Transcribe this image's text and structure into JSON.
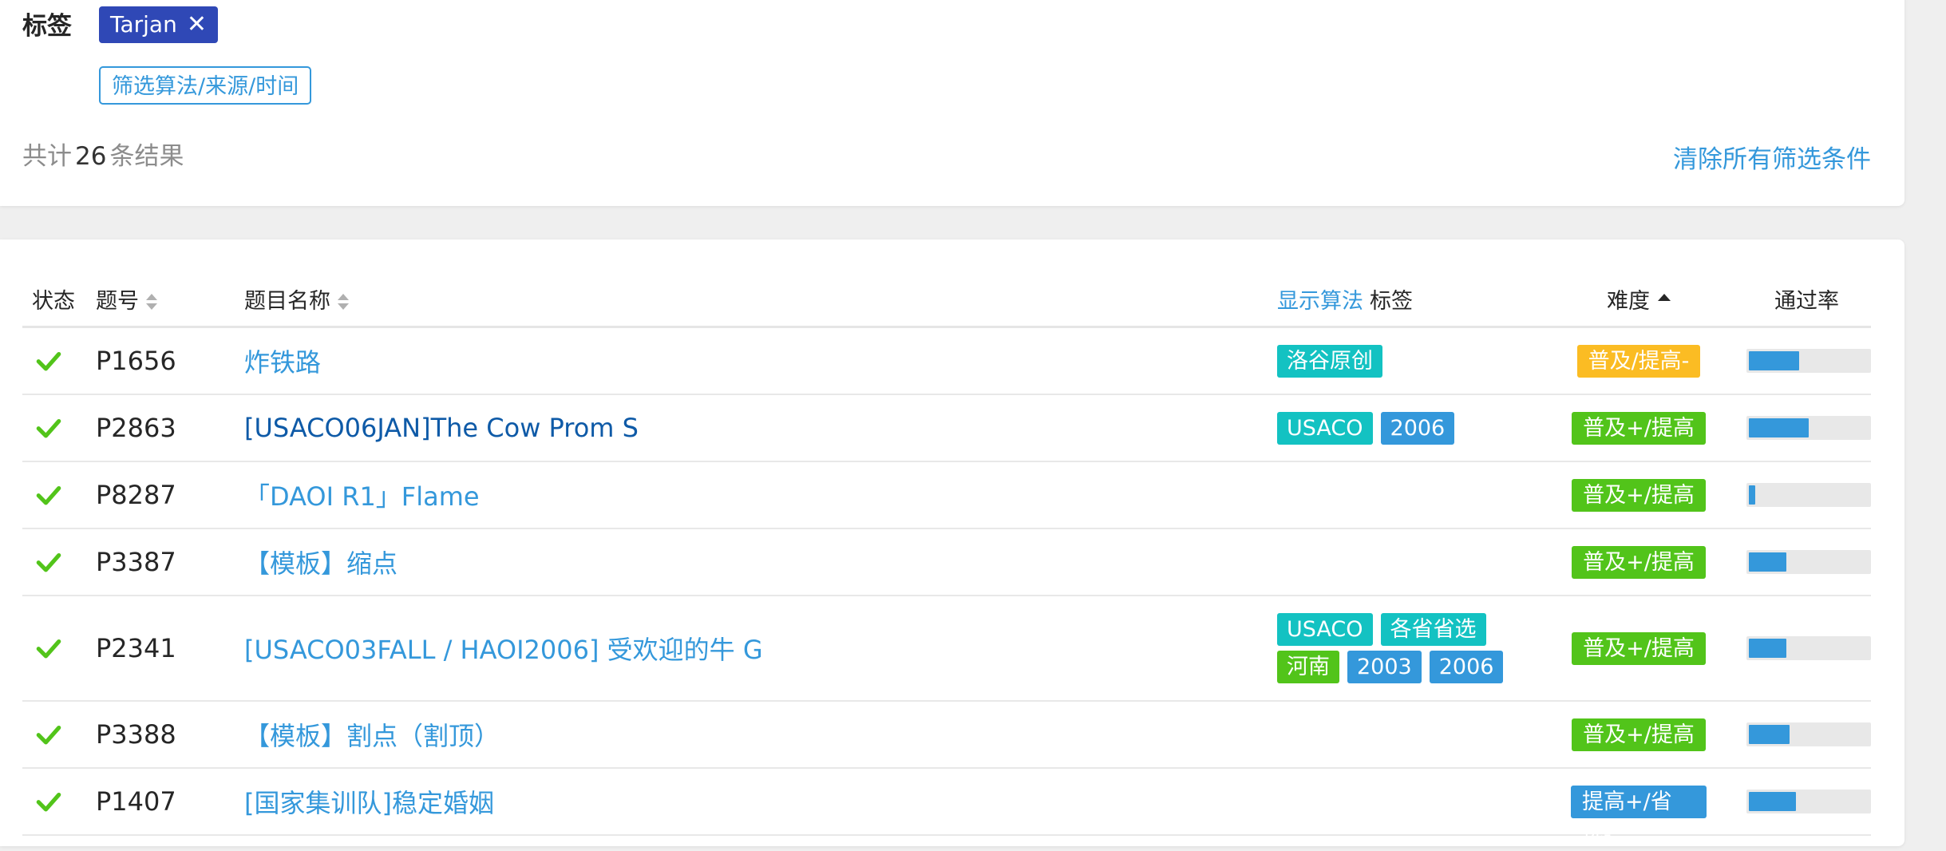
{
  "filter": {
    "tags_label": "标签",
    "active_tag": "Tarjan",
    "active_tag_close": "✕",
    "filter_button": "筛选算法/来源/时间",
    "result_prefix": "共计",
    "result_count": "26",
    "result_suffix": "条结果",
    "clear_all": "清除所有筛选条件"
  },
  "table": {
    "headers": {
      "status": "状态",
      "pid": "题号",
      "name": "题目名称",
      "show_algo": "显示算法",
      "tags": "标签",
      "difficulty": "难度",
      "pass_rate": "通过率"
    },
    "rows": [
      {
        "pid": "P1656",
        "name": "炸铁路",
        "name_style": "blue",
        "tags": [
          {
            "text": "洛谷原创",
            "color": "teal"
          }
        ],
        "difficulty": "普及/提高-",
        "difficulty_color": "#fbbc23",
        "pass_rate": 0.42
      },
      {
        "pid": "P2863",
        "name": "[USACO06JAN]The Cow Prom S",
        "name_style": "dark",
        "tags": [
          {
            "text": "USACO",
            "color": "teal"
          },
          {
            "text": "2006",
            "color": "blue"
          }
        ],
        "difficulty": "普及+/提高",
        "difficulty_color": "#52c41a",
        "pass_rate": 0.5
      },
      {
        "pid": "P8287",
        "name": "「DAOI R1」Flame",
        "name_style": "blue",
        "tags": [],
        "difficulty": "普及+/提高",
        "difficulty_color": "#52c41a",
        "pass_rate": 0.05
      },
      {
        "pid": "P3387",
        "name": "【模板】缩点",
        "name_style": "blue",
        "tags": [],
        "difficulty": "普及+/提高",
        "difficulty_color": "#52c41a",
        "pass_rate": 0.31
      },
      {
        "pid": "P2341",
        "name": "[USACO03FALL / HAOI2006] 受欢迎的牛 G",
        "name_style": "blue",
        "tags": [
          {
            "text": "USACO",
            "color": "teal"
          },
          {
            "text": "各省省选",
            "color": "teal"
          },
          {
            "text": "河南",
            "color": "green"
          },
          {
            "text": "2003",
            "color": "blue"
          },
          {
            "text": "2006",
            "color": "blue"
          }
        ],
        "difficulty": "普及+/提高",
        "difficulty_color": "#52c41a",
        "pass_rate": 0.31
      },
      {
        "pid": "P3388",
        "name": "【模板】割点（割顶）",
        "name_style": "blue",
        "tags": [],
        "difficulty": "普及+/提高",
        "difficulty_color": "#52c41a",
        "pass_rate": 0.34
      },
      {
        "pid": "P1407",
        "name": "[国家集训队]稳定婚姻",
        "name_style": "blue",
        "tags": [],
        "difficulty": "提高+/省选-",
        "difficulty_color": "#3498db",
        "pass_rate": 0.39
      }
    ]
  },
  "colors": {
    "accent": "#3498db",
    "status_ok": "#52c41a",
    "tag_chip": "#2f48b6"
  },
  "icons": {
    "status": "check-icon",
    "sort": "sort-icon",
    "sort_asc": "sort-asc-icon",
    "close": "close-icon"
  }
}
